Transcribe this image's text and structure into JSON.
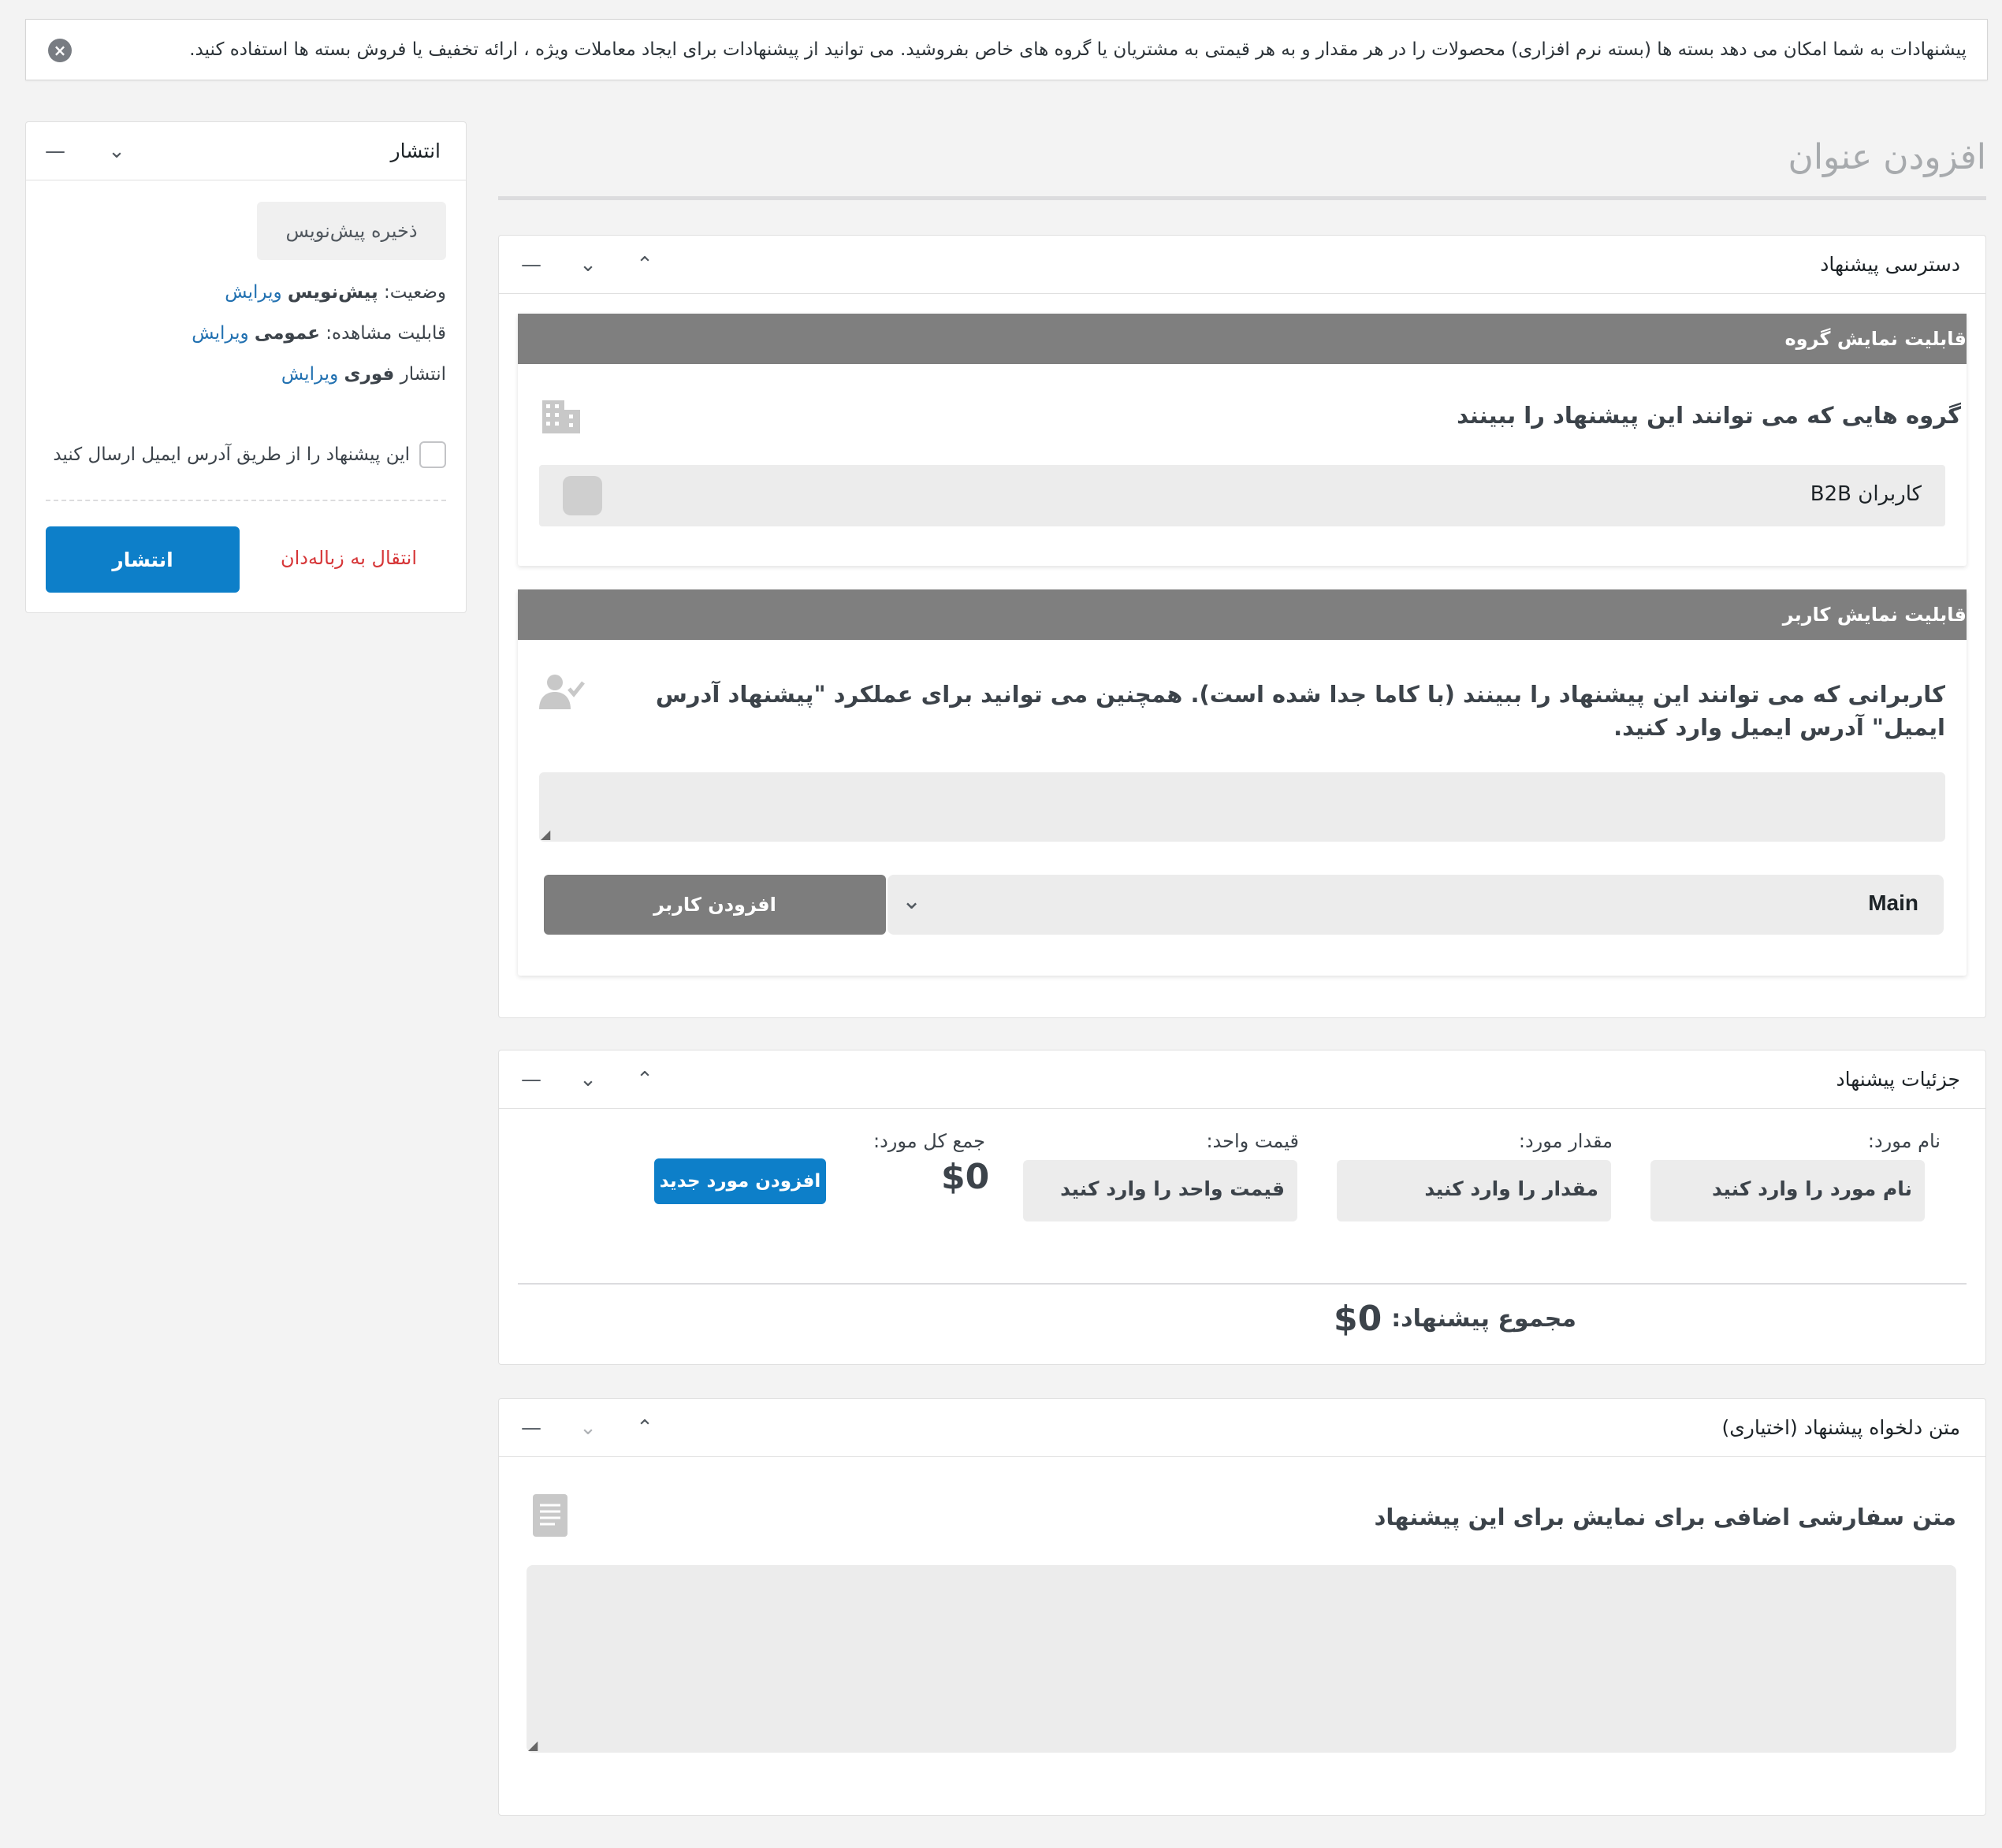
{
  "notice": {
    "text": "پیشنهادات به شما امکان می دهد بسته ها (بسته نرم افزاری) محصولات را در هر مقدار و به هر قیمتی به مشتریان یا گروه های خاص بفروشید. می توانید از پیشنهادات برای ایجاد معاملات ویژه ، ارائه تخفیف یا فروش بسته ها استفاده کنید."
  },
  "title": {
    "placeholder": "افزودن عنوان"
  },
  "access": {
    "title": "دسترسی پیشنهاد",
    "group_section": {
      "bar": "قابلیت نمایش گروه",
      "heading": "گروه هایی که می توانند این پیشنهاد را ببینند",
      "group_label": "کاربران B2B"
    },
    "user_section": {
      "bar": "قابلیت نمایش کاربر",
      "heading": "کاربرانی که می توانند این پیشنهاد را ببینند (با کاما جدا شده است). همچنین می توانید برای عملکرد \"پیشنهاد آدرس ایمیل\" آدرس ایمیل وارد کنید.",
      "select_value": "Main",
      "add_user": "افزودن کاربر"
    }
  },
  "details": {
    "title": "جزئیات پیشنهاد",
    "item_name_label": "نام مورد:",
    "item_name_placeholder": "نام مورد را وارد کنید",
    "qty_label": "مقدار مورد:",
    "qty_placeholder": "مقدار را وارد کنید",
    "unit_label": "قیمت واحد:",
    "unit_placeholder": "قیمت واحد را وارد کنید",
    "total_label": "جمع کل مورد:",
    "total_value": "$0",
    "add_item": "افزودن مورد جدید",
    "sum_label": "مجموع پیشنهاد:",
    "sum_value": "$0"
  },
  "custom_text": {
    "title": "متن دلخواه پیشنهاد (اختیاری)",
    "heading": "متن سفارشی اضافی برای نمایش برای این پیشنهاد"
  },
  "publish": {
    "title": "انتشار",
    "save_draft": "ذخیره پیش‌نویس",
    "status_label": "وضعیت:",
    "status_value": "پیش‌نویس",
    "visibility_label": "قابلیت مشاهده:",
    "visibility_value": "عمومی",
    "publish_label": "انتشار",
    "publish_value": "فوری",
    "edit": "ویرایش",
    "email_checkbox": "این پیشنهاد را از طریق آدرس ایمیل ارسال کنید",
    "trash": "انتقال به زباله‌دان",
    "publish_button": "انتشار"
  },
  "colors": {
    "accent": "#0d7fc9",
    "bar": "#7f7f7f",
    "trash": "#d63638",
    "link": "#2271b1"
  }
}
